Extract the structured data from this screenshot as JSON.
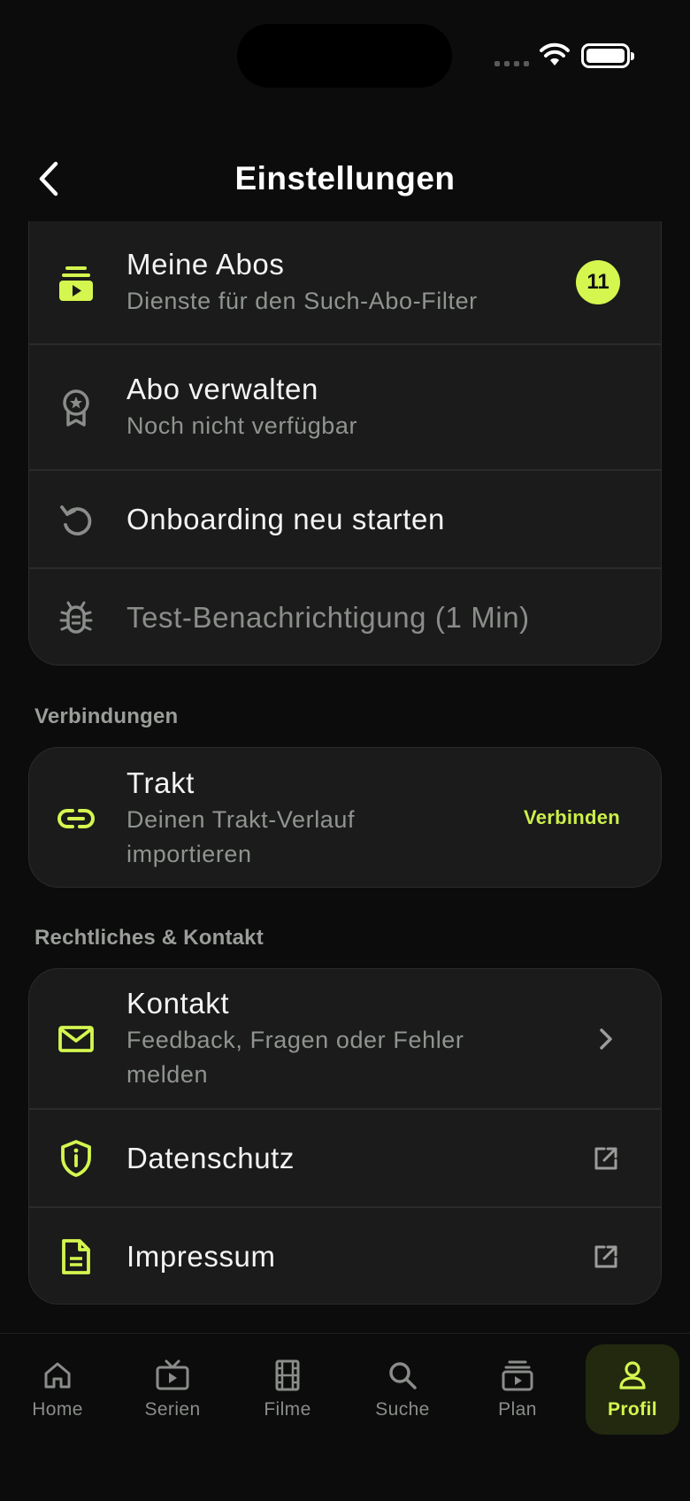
{
  "header": {
    "title": "Einstellungen"
  },
  "settings": {
    "items": [
      {
        "title": "Meine Abos",
        "subtitle": "Dienste für den Such-Abo-Filter",
        "badge": "11"
      },
      {
        "title": "Abo verwalten",
        "subtitle": "Noch nicht verfügbar"
      },
      {
        "title": "Onboarding neu starten"
      },
      {
        "title": "Test-Benachrichtigung (1 Min)"
      }
    ]
  },
  "connections": {
    "label": "Verbindungen",
    "items": [
      {
        "title": "Trakt",
        "subtitle_line1": "Deinen Trakt-Verlauf",
        "subtitle_line2": "importieren",
        "action": "Verbinden"
      }
    ]
  },
  "legal": {
    "label": "Rechtliches & Kontakt",
    "items": [
      {
        "title": "Kontakt",
        "subtitle_line1": "Feedback, Fragen oder Fehler",
        "subtitle_line2": "melden"
      },
      {
        "title": "Datenschutz"
      },
      {
        "title": "Impressum"
      }
    ]
  },
  "tabbar": {
    "tabs": [
      {
        "label": "Home",
        "icon": "home-icon"
      },
      {
        "label": "Serien",
        "icon": "tv-icon"
      },
      {
        "label": "Filme",
        "icon": "film-icon"
      },
      {
        "label": "Suche",
        "icon": "search-icon"
      },
      {
        "label": "Plan",
        "icon": "stack-icon"
      },
      {
        "label": "Profil",
        "icon": "user-icon",
        "active": true
      }
    ]
  },
  "colors": {
    "accent": "#d4f64f",
    "background": "#0b0c0b",
    "card": "#1a1b1a"
  }
}
